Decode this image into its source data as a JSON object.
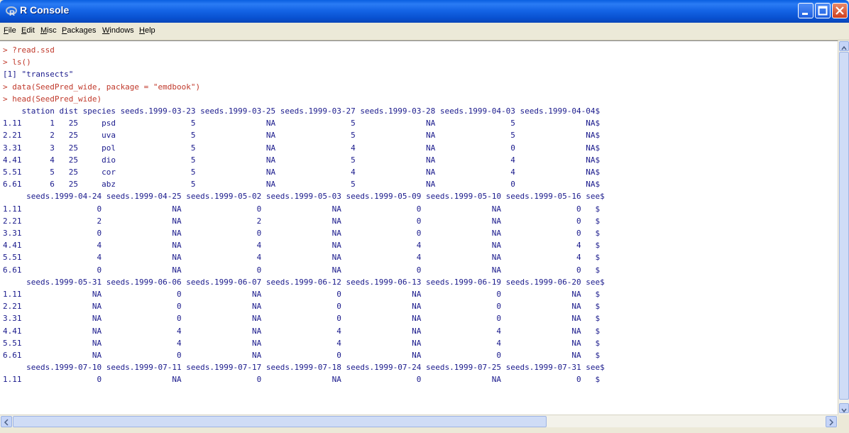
{
  "window": {
    "title": "R Console"
  },
  "menu": [
    "File",
    "Edit",
    "Misc",
    "Packages",
    "Windows",
    "Help"
  ],
  "console_lines": [
    {
      "kind": "cmd",
      "text": "> ?read.ssd"
    },
    {
      "kind": "cmd",
      "text": "> ls()"
    },
    {
      "kind": "out",
      "text": "[1] \"transects\""
    },
    {
      "kind": "cmd",
      "text": "> data(SeedPred_wide, package = \"emdbook\")"
    },
    {
      "kind": "cmd",
      "text": "> head(SeedPred_wide)"
    },
    {
      "kind": "out",
      "text": "    station dist species seeds.1999-03-23 seeds.1999-03-25 seeds.1999-03-27 seeds.1999-03-28 seeds.1999-04-03 seeds.1999-04-04$"
    },
    {
      "kind": "out",
      "text": "1.11      1   25     psd                5               NA                5               NA                5               NA$"
    },
    {
      "kind": "out",
      "text": "2.21      2   25     uva                5               NA                5               NA                5               NA$"
    },
    {
      "kind": "out",
      "text": "3.31      3   25     pol                5               NA                4               NA                0               NA$"
    },
    {
      "kind": "out",
      "text": "4.41      4   25     dio                5               NA                5               NA                4               NA$"
    },
    {
      "kind": "out",
      "text": "5.51      5   25     cor                5               NA                4               NA                4               NA$"
    },
    {
      "kind": "out",
      "text": "6.61      6   25     abz                5               NA                5               NA                0               NA$"
    },
    {
      "kind": "out",
      "text": "     seeds.1999-04-24 seeds.1999-04-25 seeds.1999-05-02 seeds.1999-05-03 seeds.1999-05-09 seeds.1999-05-10 seeds.1999-05-16 see$"
    },
    {
      "kind": "out",
      "text": "1.11                0               NA                0               NA                0               NA                0   $"
    },
    {
      "kind": "out",
      "text": "2.21                2               NA                2               NA                0               NA                0   $"
    },
    {
      "kind": "out",
      "text": "3.31                0               NA                0               NA                0               NA                0   $"
    },
    {
      "kind": "out",
      "text": "4.41                4               NA                4               NA                4               NA                4   $"
    },
    {
      "kind": "out",
      "text": "5.51                4               NA                4               NA                4               NA                4   $"
    },
    {
      "kind": "out",
      "text": "6.61                0               NA                0               NA                0               NA                0   $"
    },
    {
      "kind": "out",
      "text": "     seeds.1999-05-31 seeds.1999-06-06 seeds.1999-06-07 seeds.1999-06-12 seeds.1999-06-13 seeds.1999-06-19 seeds.1999-06-20 see$"
    },
    {
      "kind": "out",
      "text": "1.11               NA                0               NA                0               NA                0               NA   $"
    },
    {
      "kind": "out",
      "text": "2.21               NA                0               NA                0               NA                0               NA   $"
    },
    {
      "kind": "out",
      "text": "3.31               NA                0               NA                0               NA                0               NA   $"
    },
    {
      "kind": "out",
      "text": "4.41               NA                4               NA                4               NA                4               NA   $"
    },
    {
      "kind": "out",
      "text": "5.51               NA                4               NA                4               NA                4               NA   $"
    },
    {
      "kind": "out",
      "text": "6.61               NA                0               NA                0               NA                0               NA   $"
    },
    {
      "kind": "out",
      "text": "     seeds.1999-07-10 seeds.1999-07-11 seeds.1999-07-17 seeds.1999-07-18 seeds.1999-07-24 seeds.1999-07-25 seeds.1999-07-31 see$"
    },
    {
      "kind": "out",
      "text": "1.11                0               NA                0               NA                0               NA                0   $"
    }
  ],
  "colors": {
    "command": "#c0392b",
    "output": "#1a1a8c",
    "titlebar": "#0a5fe0"
  },
  "icons": {
    "app": "r-logo-icon",
    "minimize": "minimize-icon",
    "maximize": "maximize-icon",
    "close": "close-icon"
  }
}
